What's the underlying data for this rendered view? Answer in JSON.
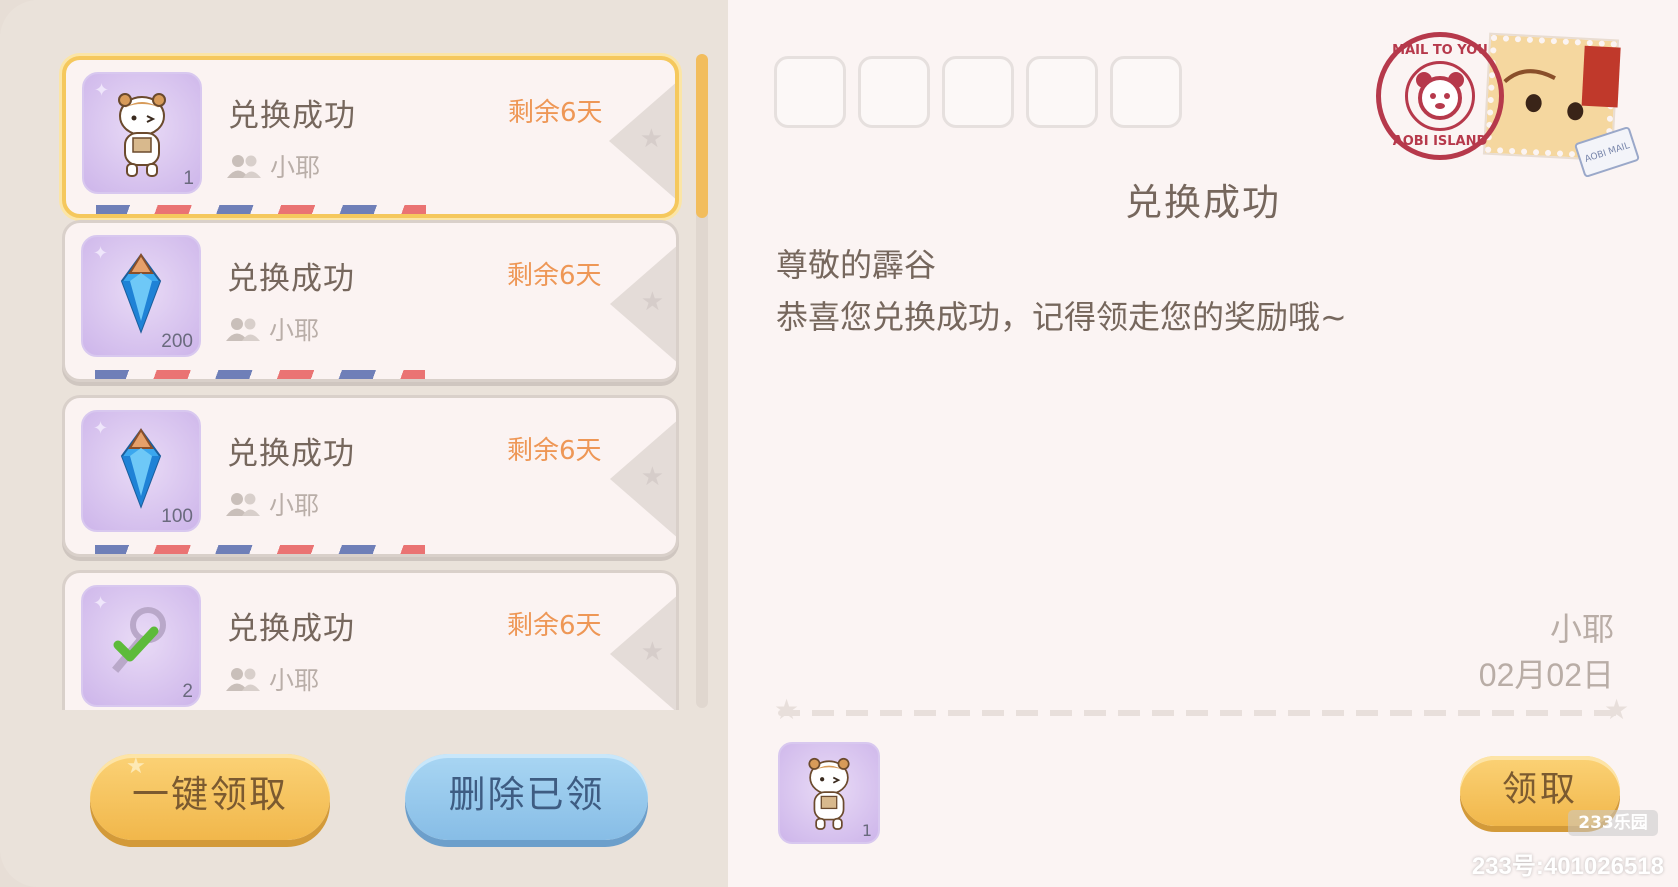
{
  "mail_list": [
    {
      "title": "兑换成功",
      "remaining": "剩余6天",
      "sender": "小耶",
      "item_qty": "1",
      "item_icon": "hamster-character-icon",
      "selected": true
    },
    {
      "title": "兑换成功",
      "remaining": "剩余6天",
      "sender": "小耶",
      "item_qty": "200",
      "item_icon": "blue-diamond-icon",
      "selected": false
    },
    {
      "title": "兑换成功",
      "remaining": "剩余6天",
      "sender": "小耶",
      "item_qty": "100",
      "item_icon": "blue-diamond-icon",
      "selected": false
    },
    {
      "title": "兑换成功",
      "remaining": "剩余6天",
      "sender": "小耶",
      "item_qty": "2",
      "item_icon": "key-checkmark-icon",
      "selected": false
    }
  ],
  "buttons": {
    "claim_all": "一键领取",
    "delete_claimed": "删除已领",
    "claim": "领取"
  },
  "letter": {
    "title": "兑换成功",
    "greeting": "尊敬的霹谷",
    "body": "恭喜您兑换成功，记得领走您的奖励哦~",
    "sender": "小耶",
    "date": "02月02日",
    "attachment_qty": "1",
    "attachment_icon": "hamster-character-icon"
  },
  "postmark": {
    "top_text": "MAIL TO YOU",
    "bottom_text": "AOBI ISLAND"
  },
  "airmail_label": "AOBI MAIL",
  "watermark": {
    "logo": "233乐园",
    "id": "233号:401026518"
  },
  "colors": {
    "accent_orange": "#ee9756",
    "gold_button": "#f1b74b",
    "blue_button": "#87bde6",
    "selected_border": "#f5c85d",
    "text_brown": "#76675d"
  }
}
